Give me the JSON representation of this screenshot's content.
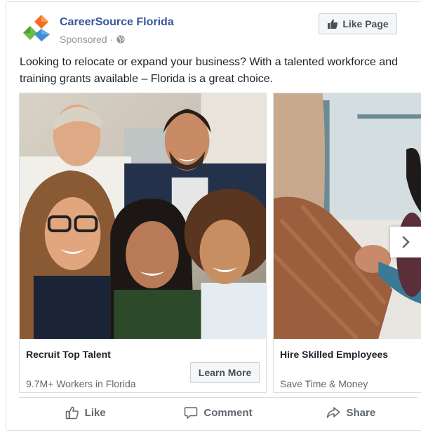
{
  "post": {
    "page_name": "CareerSource Florida",
    "sponsored_label": "Sponsored",
    "separator": "·",
    "like_page_label": "Like Page",
    "caption": "Looking to relocate or expand your business? With a talented workforce and training grants available – Florida is a great choice."
  },
  "carousel": {
    "cards": [
      {
        "headline": "Recruit Top Talent",
        "description": "9.7M+ Workers in Florida",
        "cta_label": "Learn More"
      },
      {
        "headline": "Hire Skilled Employees",
        "description": "Save Time & Money"
      }
    ]
  },
  "actions": {
    "like_label": "Like",
    "comment_label": "Comment",
    "share_label": "Share"
  },
  "colors": {
    "brand_link": "#365899",
    "logo_orange": "#f26f21",
    "logo_green": "#6cbe45",
    "logo_blue": "#3d8fd1"
  }
}
